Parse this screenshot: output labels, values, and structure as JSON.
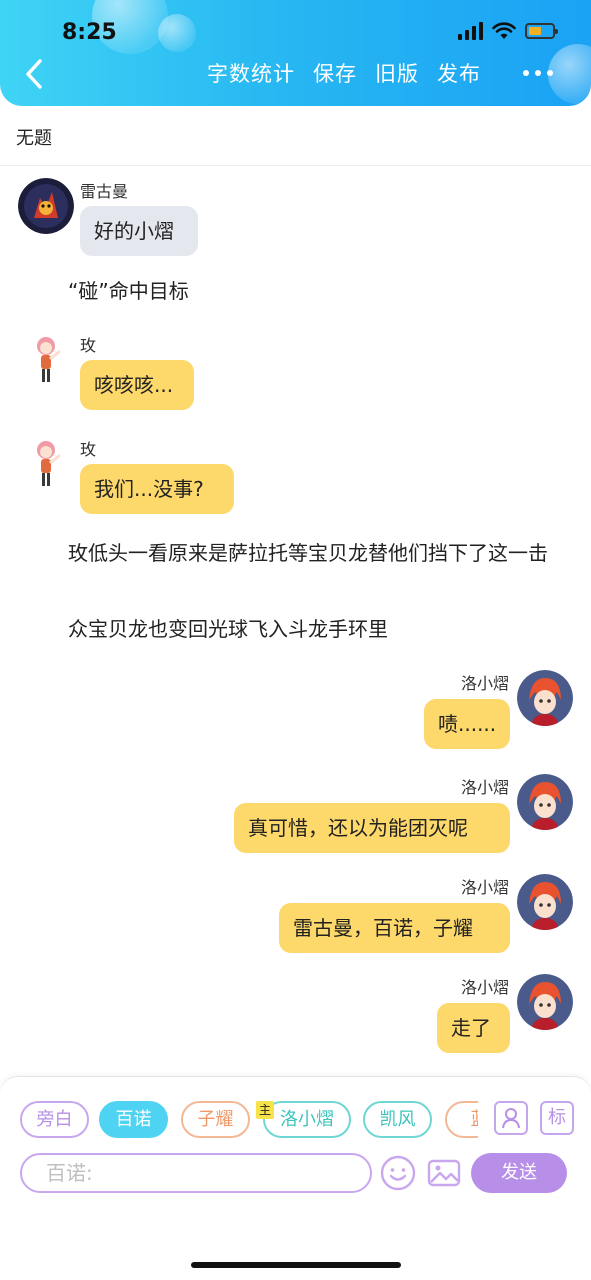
{
  "status_bar": {
    "time": "8:25"
  },
  "header": {
    "actions": [
      "字数统计",
      "保存",
      "旧版",
      "发布"
    ],
    "colors": {
      "gradient_start": "#3fd4f5",
      "gradient_end": "#1aa2f4"
    }
  },
  "document": {
    "title": "无题"
  },
  "messages": [
    {
      "type": "left",
      "speaker": "雷古曼",
      "avatar": "dragon-avatar",
      "text": "好的小熠",
      "bubble": "gray"
    },
    {
      "type": "narration",
      "text": "“碰”命中目标"
    },
    {
      "type": "left",
      "speaker": "玫",
      "avatar": "girl-avatar",
      "text": "咳咳咳...",
      "bubble": "yellow"
    },
    {
      "type": "left",
      "speaker": "玫",
      "avatar": "girl-avatar",
      "text": "我们...没事?",
      "bubble": "yellow"
    },
    {
      "type": "narration",
      "text": "玫低头一看原来是萨拉托等宝贝龙替他们挡下了这一击"
    },
    {
      "type": "narration",
      "text": "众宝贝龙也变回光球飞入斗龙手环里"
    },
    {
      "type": "right",
      "speaker": "洛小熠",
      "avatar": "boy-avatar",
      "text": "啧......",
      "bubble": "yellow"
    },
    {
      "type": "right",
      "speaker": "洛小熠",
      "avatar": "boy-avatar",
      "text": "真可惜，还以为能团灭呢",
      "bubble": "yellow"
    },
    {
      "type": "right",
      "speaker": "洛小熠",
      "avatar": "boy-avatar",
      "text": "雷古曼，百诺，子耀",
      "bubble": "yellow"
    },
    {
      "type": "right",
      "speaker": "洛小熠",
      "avatar": "boy-avatar",
      "text": "走了",
      "bubble": "yellow"
    }
  ],
  "composer": {
    "chips": [
      {
        "label": "旁白",
        "style": "purple"
      },
      {
        "label": "百诺",
        "style": "active"
      },
      {
        "label": "子耀",
        "style": "orange"
      },
      {
        "label": "洛小熠",
        "style": "teal",
        "tag": "主"
      },
      {
        "label": "凯风",
        "style": "teal"
      },
      {
        "label": "蓝",
        "style": "orange"
      }
    ],
    "mark_label": "标",
    "placeholder": "百诺:",
    "send_label": "发送"
  }
}
